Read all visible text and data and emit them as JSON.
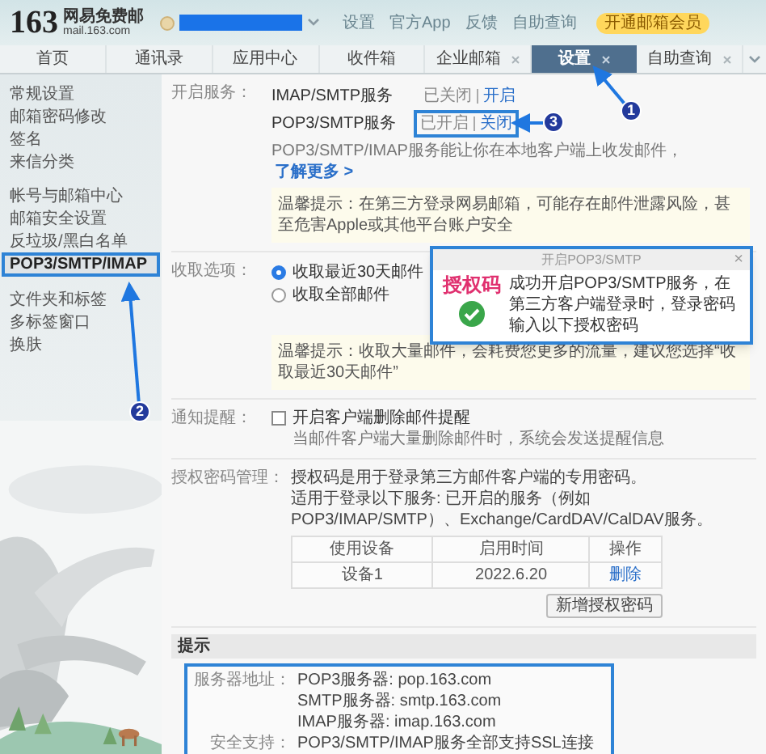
{
  "header": {
    "logo": "163",
    "brand": "网易免费邮",
    "domain": "mail.163.com",
    "links": [
      "设置",
      "官方App",
      "反馈",
      "自助查询"
    ],
    "vip_badge": "开通邮箱会员"
  },
  "tabs": [
    {
      "label": "首页",
      "selected": false,
      "closable": false
    },
    {
      "label": "通讯录",
      "selected": false,
      "closable": false
    },
    {
      "label": "应用中心",
      "selected": false,
      "closable": false
    },
    {
      "label": "收件箱",
      "selected": false,
      "closable": false
    },
    {
      "label": "企业邮箱",
      "selected": false,
      "closable": true
    },
    {
      "label": "设置",
      "selected": true,
      "closable": true
    },
    {
      "label": "自助查询",
      "selected": false,
      "closable": true
    }
  ],
  "sidebar": {
    "groups": [
      [
        {
          "label": "常规设置",
          "selected": false
        },
        {
          "label": "邮箱密码修改",
          "selected": false
        },
        {
          "label": "签名",
          "selected": false
        },
        {
          "label": "来信分类",
          "selected": false
        }
      ],
      [
        {
          "label": "帐号与邮箱中心",
          "selected": false
        },
        {
          "label": "邮箱安全设置",
          "selected": false
        },
        {
          "label": "反垃圾/黑白名单",
          "selected": false
        },
        {
          "label": "POP3/SMTP/IMAP",
          "selected": true
        }
      ],
      [
        {
          "label": "文件夹和标签",
          "selected": false
        },
        {
          "label": "多标签窗口",
          "selected": false
        },
        {
          "label": "换肤",
          "selected": false
        }
      ]
    ]
  },
  "services": {
    "label": "开启服务：",
    "items": [
      {
        "name": "IMAP/SMTP服务",
        "status": "已关闭",
        "action": "开启",
        "highlighted": false
      },
      {
        "name": "POP3/SMTP服务",
        "status": "已开启",
        "action": "关闭",
        "highlighted": true
      }
    ],
    "description": "POP3/SMTP/IMAP服务能让你在本地客户端上收发邮件，",
    "learn_more": "了解更多 >",
    "tip": "温馨提示：在第三方登录网易邮箱，可能存在邮件泄露风险，甚至危害Apple或其他平台账户安全"
  },
  "dialog": {
    "title": "开启POP3/SMTP",
    "close": "×",
    "annotation": "授权码",
    "message": "成功开启POP3/SMTP服务，在第三方客户端登录时，登录密码输入以下授权密码"
  },
  "receive": {
    "label": "收取选项：",
    "options": [
      {
        "label": "收取最近30天邮件",
        "selected": true
      },
      {
        "label": "收取全部邮件",
        "selected": false
      }
    ],
    "tip": "温馨提示：收取大量邮件，会耗费您更多的流量，建议您选择“收取最近30天邮件”"
  },
  "notify": {
    "label": "通知提醒：",
    "checkbox": {
      "label": "开启客户端删除邮件提醒",
      "checked": false
    },
    "note": "当邮件客户端大量删除邮件时，系统会发送提醒信息"
  },
  "auth": {
    "label": "授权密码管理：",
    "lines": [
      "授权码是用于登录第三方邮件客户端的专用密码。",
      "适用于登录以下服务: 已开启的服务（例如POP3/IMAP/SMTP）、Exchange/CardDAV/CalDAV服务。"
    ],
    "table": {
      "columns": [
        "使用设备",
        "启用时间",
        "操作"
      ],
      "rows": [
        [
          "设备1",
          "2022.6.20",
          "删除"
        ]
      ]
    },
    "button": "新增授权密码"
  },
  "hints": {
    "title": "提示",
    "rows": [
      {
        "label": "服务器地址：",
        "value": "POP3服务器: pop.163.com"
      },
      {
        "value": "SMTP服务器: smtp.163.com"
      },
      {
        "value": "IMAP服务器: imap.163.com"
      },
      {
        "label": "安全支持：",
        "value": "POP3/SMTP/IMAP服务全部支持SSL连接"
      }
    ]
  },
  "annotations": [
    {
      "label": "1"
    },
    {
      "label": "2"
    },
    {
      "label": "3"
    }
  ]
}
